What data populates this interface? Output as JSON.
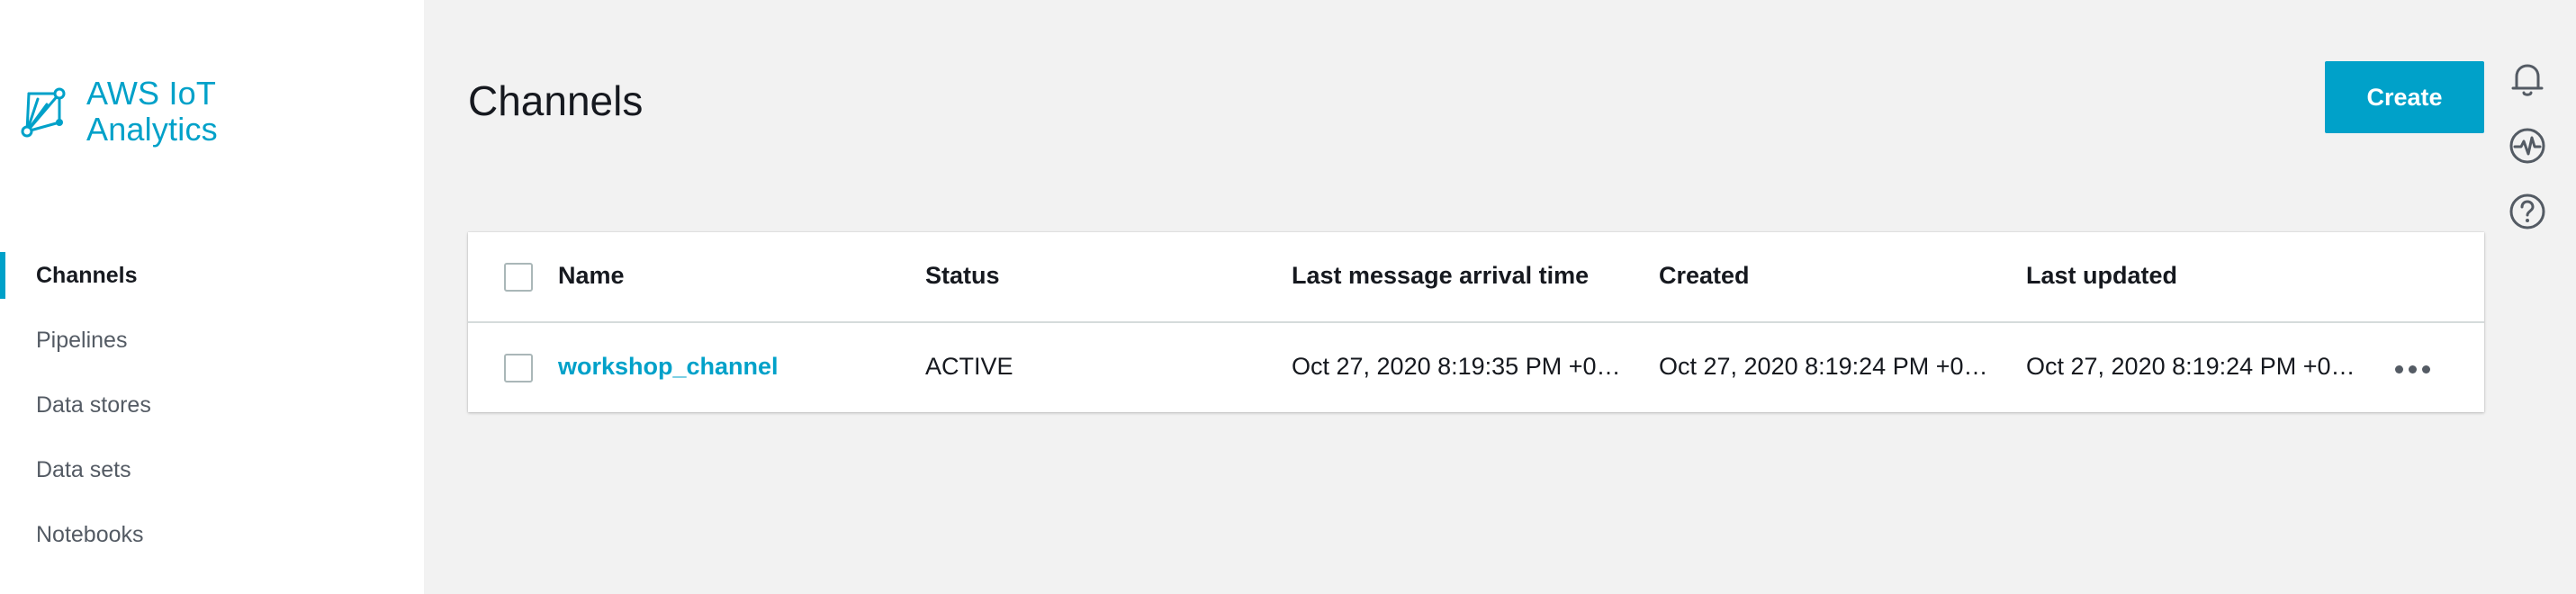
{
  "brand": {
    "line1": "AWS IoT",
    "line2": "Analytics",
    "logo_icon": "iot-analytics-logo-icon",
    "color": "#00a1c9"
  },
  "sidebar": {
    "items": [
      {
        "label": "Channels",
        "active": true
      },
      {
        "label": "Pipelines",
        "active": false
      },
      {
        "label": "Data stores",
        "active": false
      },
      {
        "label": "Data sets",
        "active": false
      },
      {
        "label": "Notebooks",
        "active": false
      }
    ]
  },
  "header": {
    "title": "Channels",
    "create_label": "Create"
  },
  "rail": {
    "icons": [
      "bell-icon",
      "pulse-icon",
      "help-icon"
    ]
  },
  "table": {
    "columns": [
      "Name",
      "Status",
      "Last message arrival time",
      "Created",
      "Last updated"
    ],
    "rows": [
      {
        "name": "workshop_channel",
        "status": "ACTIVE",
        "last_message": "Oct 27, 2020 8:19:35 PM +0…",
        "created": "Oct 27, 2020 8:19:24 PM +0…",
        "last_updated": "Oct 27, 2020 8:19:24 PM +0…"
      }
    ]
  },
  "colors": {
    "accent": "#00a1c9",
    "background": "#f2f2f2",
    "text": "#16191f"
  }
}
